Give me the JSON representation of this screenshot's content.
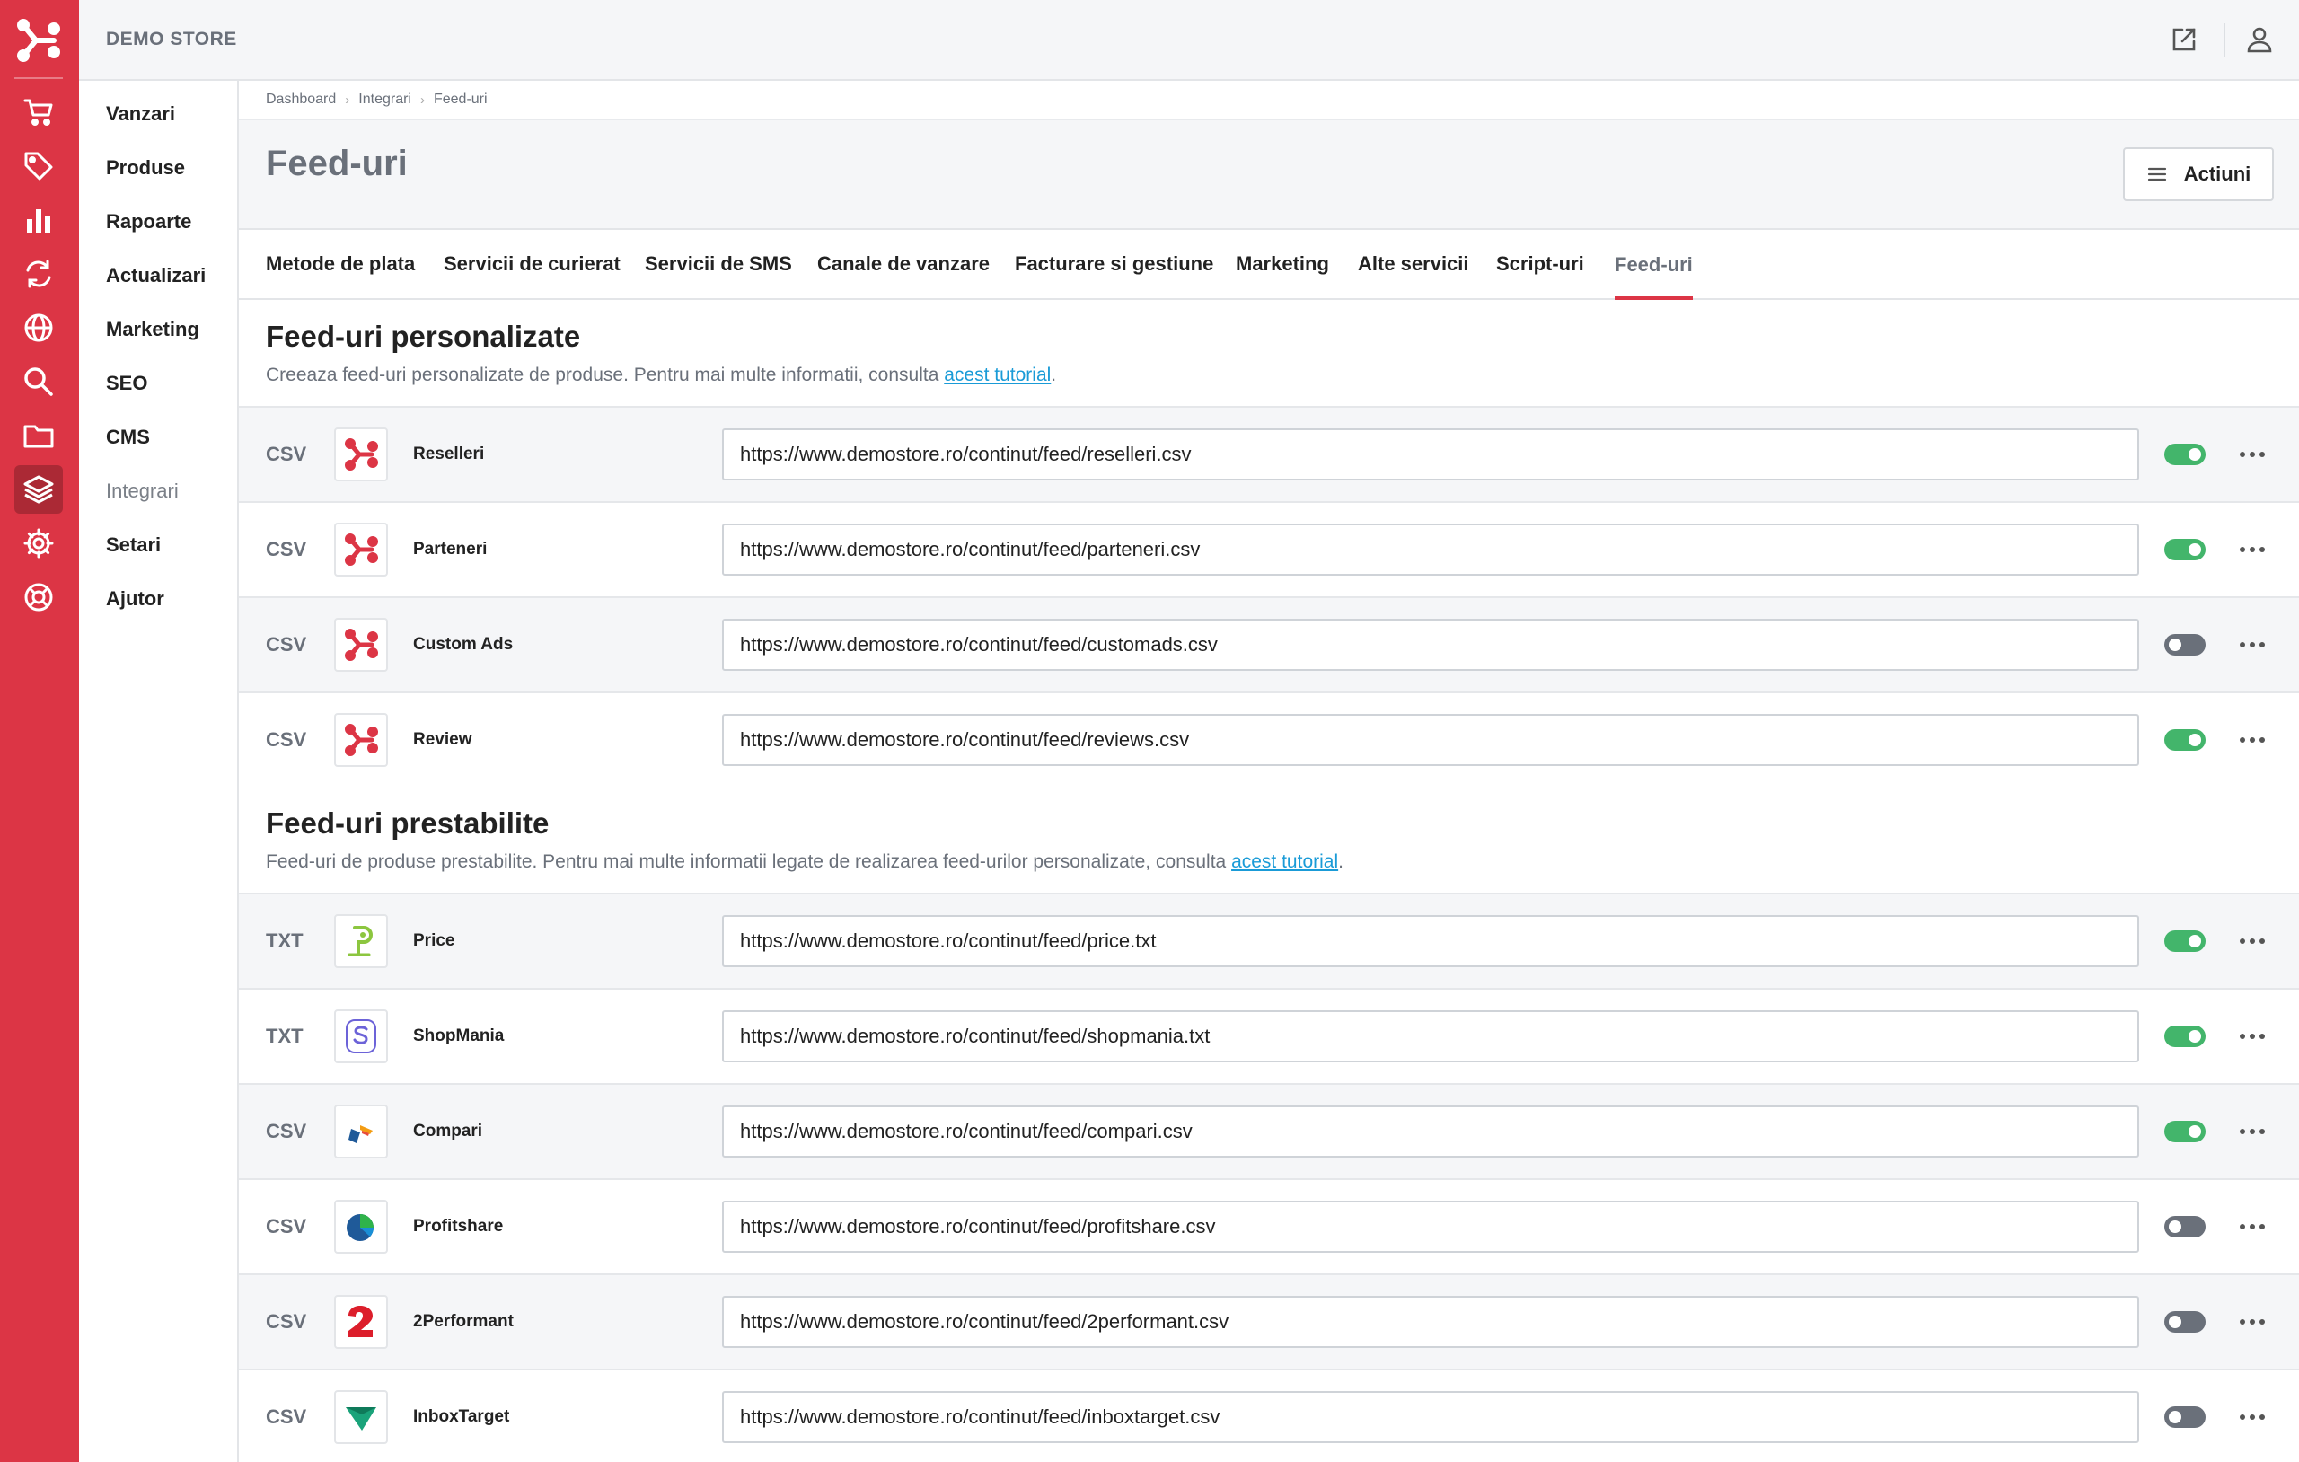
{
  "app": {
    "store_name": "DEMO STORE",
    "accent_color": "#dc3545",
    "toggle_on_color": "#43b56b",
    "toggle_off_color": "#6a707a"
  },
  "rail_icons": [
    "brand-logo-icon",
    "cart-icon",
    "tag-icon",
    "bar-chart-icon",
    "sync-icon",
    "globe-icon",
    "search-icon",
    "folder-icon",
    "layers-icon",
    "gear-icon",
    "lifebuoy-icon"
  ],
  "topbar": {
    "icons": [
      "external-link-icon",
      "user-icon"
    ]
  },
  "subnav": {
    "items": [
      {
        "label": "Vanzari"
      },
      {
        "label": "Produse"
      },
      {
        "label": "Rapoarte"
      },
      {
        "label": "Actualizari"
      },
      {
        "label": "Marketing"
      },
      {
        "label": "SEO"
      },
      {
        "label": "CMS"
      },
      {
        "label": "Integrari"
      },
      {
        "label": "Setari"
      },
      {
        "label": "Ajutor"
      }
    ],
    "active": "Integrari"
  },
  "breadcrumb": [
    "Dashboard",
    "Integrari",
    "Feed-uri"
  ],
  "page": {
    "title": "Feed-uri",
    "actions_label": "Actiuni"
  },
  "tabs": [
    {
      "label": "Metode de plata"
    },
    {
      "label": "Servicii de curierat"
    },
    {
      "label": "Servicii de SMS"
    },
    {
      "label": "Canale de vanzare"
    },
    {
      "label": "Facturare si gestiune"
    },
    {
      "label": "Marketing"
    },
    {
      "label": "Alte servicii"
    },
    {
      "label": "Script-uri"
    },
    {
      "label": "Feed-uri"
    }
  ],
  "active_tab": "Feed-uri",
  "custom_section": {
    "title": "Feed-uri personalizate",
    "desc_prefix": "Creeaza feed-uri personalizate de produse. Pentru mai multe informatii, consulta ",
    "link": "acest tutorial",
    "desc_suffix": ".",
    "feeds": [
      {
        "type": "CSV",
        "name": "Reselleri",
        "url": "https://www.demostore.ro/continut/feed/reselleri.csv",
        "enabled": true,
        "logo": "brand-logo-icon"
      },
      {
        "type": "CSV",
        "name": "Parteneri",
        "url": "https://www.demostore.ro/continut/feed/parteneri.csv",
        "enabled": true,
        "logo": "brand-logo-icon"
      },
      {
        "type": "CSV",
        "name": "Custom Ads",
        "url": "https://www.demostore.ro/continut/feed/customads.csv",
        "enabled": false,
        "logo": "brand-logo-icon"
      },
      {
        "type": "CSV",
        "name": "Review",
        "url": "https://www.demostore.ro/continut/feed/reviews.csv",
        "enabled": true,
        "logo": "brand-logo-icon"
      }
    ]
  },
  "default_section": {
    "title": "Feed-uri prestabilite",
    "desc_prefix": "Feed-uri de produse prestabilite. Pentru mai multe informatii legate de realizarea feed-urilor personalizate, consulta ",
    "link": "acest tutorial",
    "desc_suffix": ".",
    "feeds": [
      {
        "type": "TXT",
        "name": "Price",
        "url": "https://www.demostore.ro/continut/feed/price.txt",
        "enabled": true,
        "logo": "price-logo-icon"
      },
      {
        "type": "TXT",
        "name": "ShopMania",
        "url": "https://www.demostore.ro/continut/feed/shopmania.txt",
        "enabled": true,
        "logo": "shopmania-logo-icon"
      },
      {
        "type": "CSV",
        "name": "Compari",
        "url": "https://www.demostore.ro/continut/feed/compari.csv",
        "enabled": true,
        "logo": "compari-logo-icon"
      },
      {
        "type": "CSV",
        "name": "Profitshare",
        "url": "https://www.demostore.ro/continut/feed/profitshare.csv",
        "enabled": false,
        "logo": "profitshare-logo-icon"
      },
      {
        "type": "CSV",
        "name": "2Performant",
        "url": "https://www.demostore.ro/continut/feed/2performant.csv",
        "enabled": false,
        "logo": "2performant-logo-icon"
      },
      {
        "type": "CSV",
        "name": "InboxTarget",
        "url": "https://www.demostore.ro/continut/feed/inboxtarget.csv",
        "enabled": false,
        "logo": "inboxtarget-logo-icon"
      }
    ]
  }
}
